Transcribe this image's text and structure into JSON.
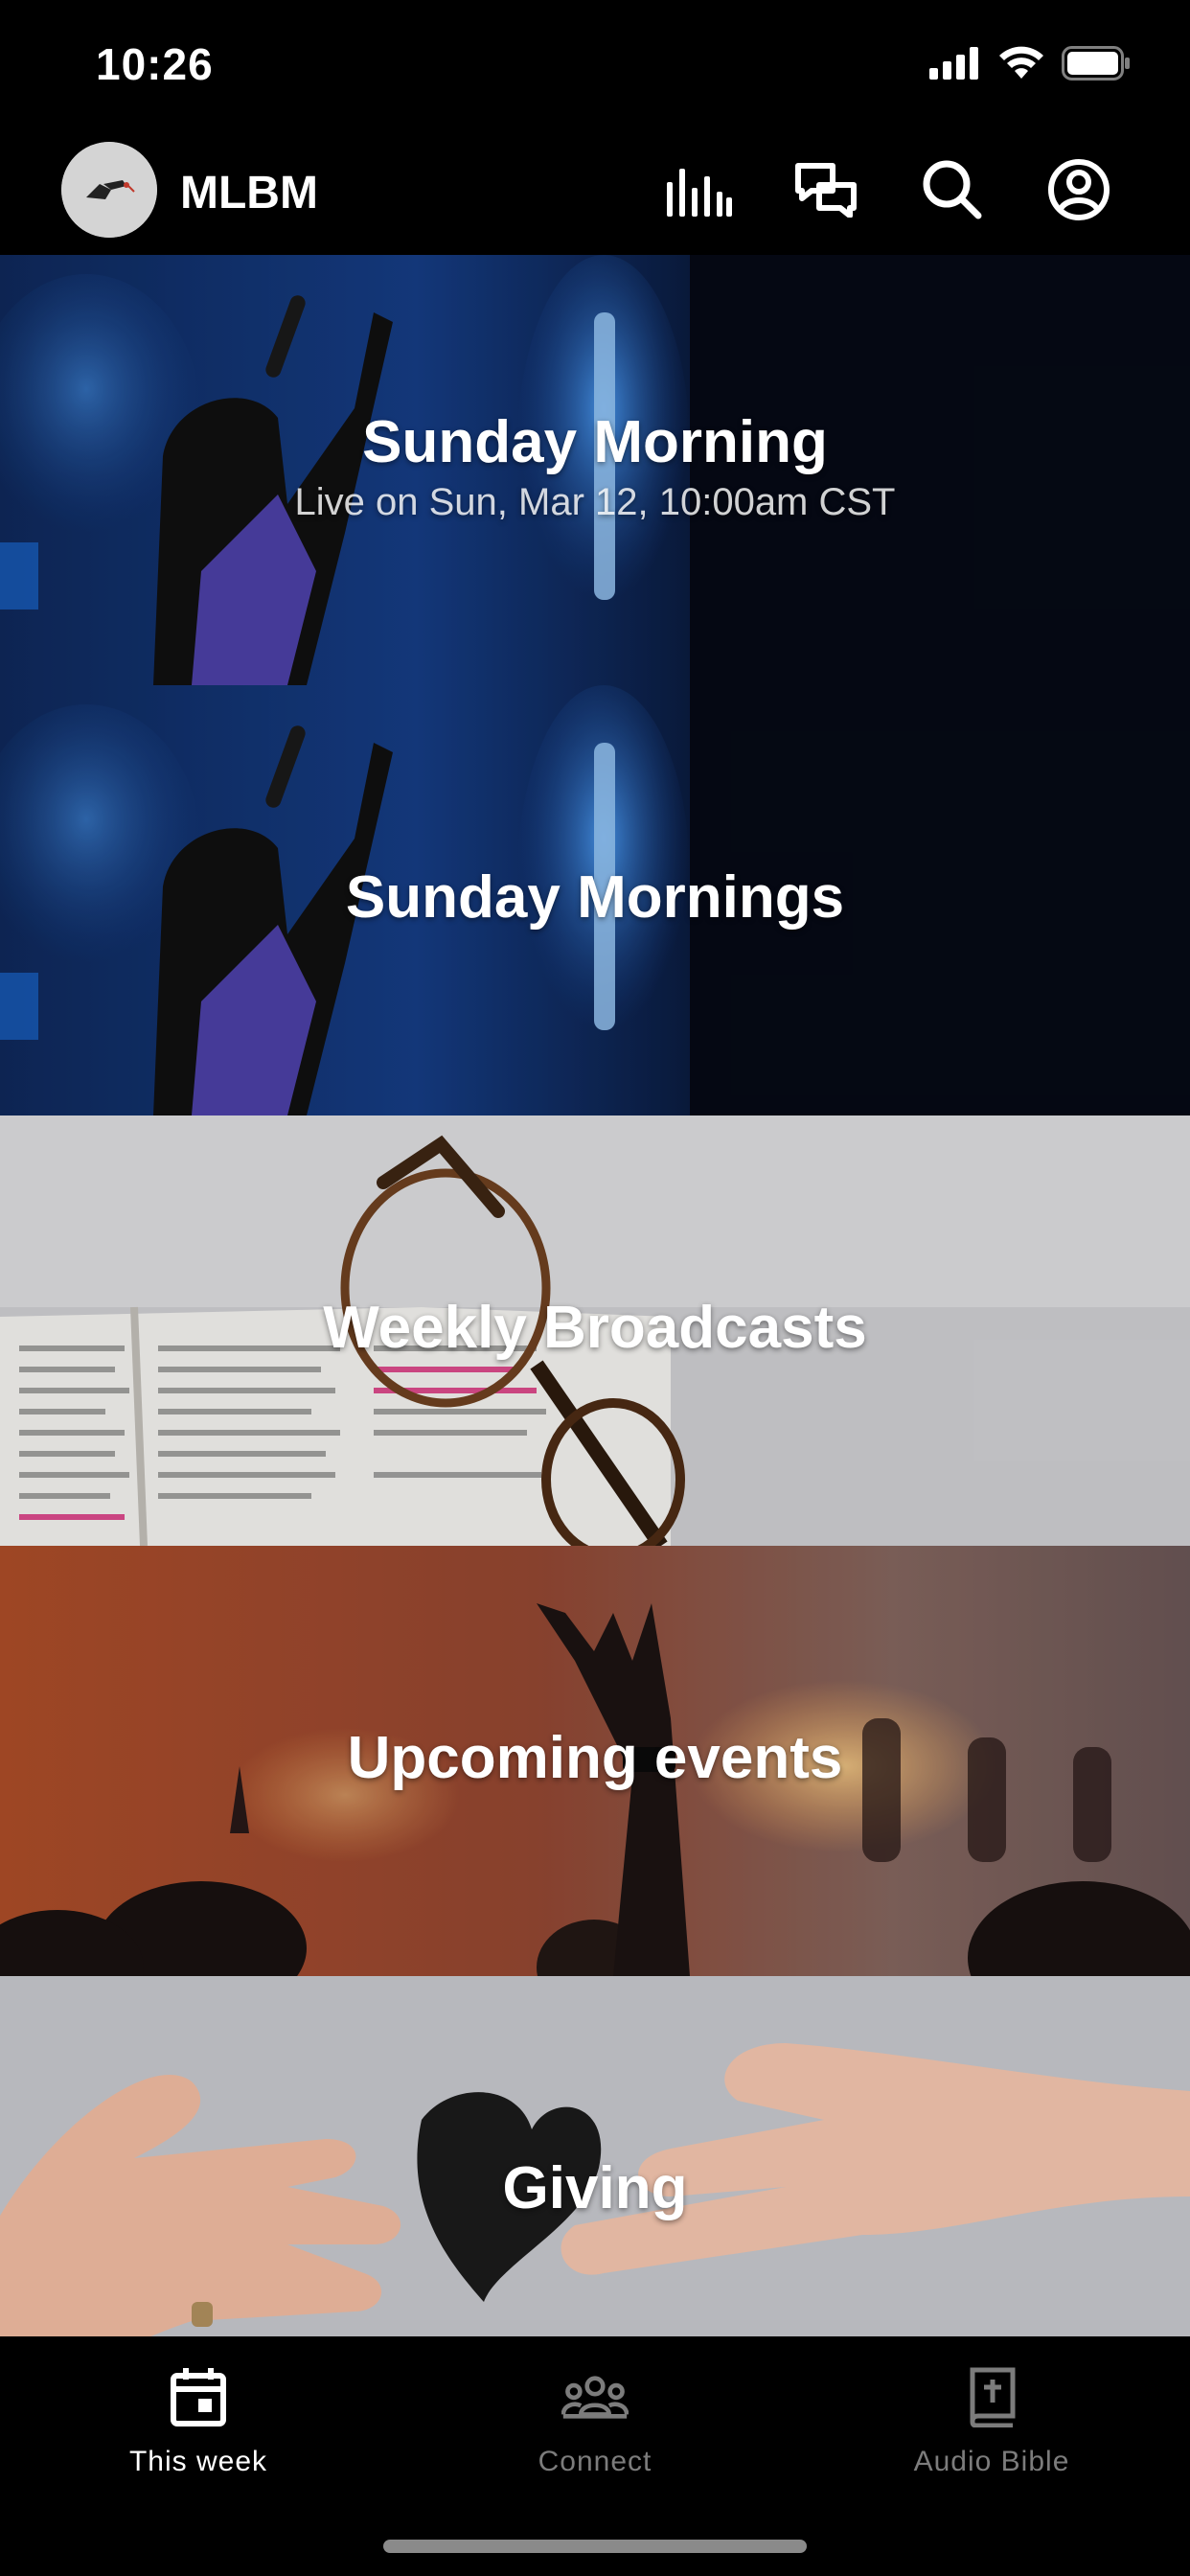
{
  "status_bar": {
    "time": "10:26",
    "icons": [
      "cellular-signal-icon",
      "wifi-icon",
      "battery-icon"
    ]
  },
  "header": {
    "app_name": "MLBM",
    "logo": "church-logo",
    "actions": [
      {
        "name": "audio-levels-icon"
      },
      {
        "name": "chat-bubbles-icon"
      },
      {
        "name": "search-icon"
      },
      {
        "name": "account-icon"
      }
    ]
  },
  "feed": {
    "cards": [
      {
        "title": "Sunday Morning",
        "subtitle": "Live on Sun, Mar 12, 10:00am CST",
        "image": "worship-singer-blue-stage"
      },
      {
        "title": "Sunday Mornings",
        "subtitle": "",
        "image": "worship-singer-blue-stage"
      },
      {
        "title": "Weekly Broadcasts",
        "subtitle": "",
        "image": "bible-and-glasses"
      },
      {
        "title": "Upcoming events",
        "subtitle": "",
        "image": "concert-raised-hands"
      },
      {
        "title": "Giving",
        "subtitle": "",
        "image": "hands-passing-heart"
      }
    ]
  },
  "tab_bar": {
    "tabs": [
      {
        "label": "This week",
        "icon": "calendar-icon",
        "active": true
      },
      {
        "label": "Connect",
        "icon": "group-icon",
        "active": false
      },
      {
        "label": "Audio Bible",
        "icon": "bible-book-icon",
        "active": false
      }
    ]
  },
  "colors": {
    "background": "#000000",
    "active_tab": "#ffffff",
    "inactive_tab": "#7c7c7c"
  }
}
